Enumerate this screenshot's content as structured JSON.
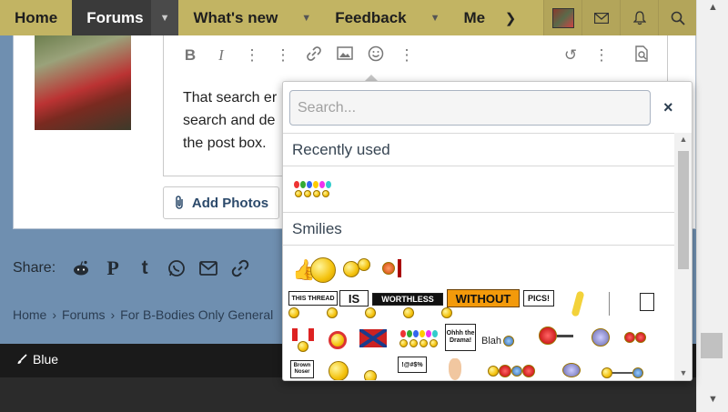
{
  "nav": {
    "items": [
      {
        "label": "Home"
      },
      {
        "label": "Forums"
      },
      {
        "label": "What's new"
      },
      {
        "label": "Feedback"
      },
      {
        "label": "Me"
      }
    ]
  },
  "editor": {
    "lines": [
      "That search er",
      "search and de",
      "the post box."
    ]
  },
  "add_photos": {
    "label": "Add Photos"
  },
  "share": {
    "label": "Share:"
  },
  "breadcrumb": [
    "Home",
    "Forums",
    "For B-Bodies Only General"
  ],
  "footer": {
    "style_label": "Blue"
  },
  "smilie_popup": {
    "search_placeholder": "Search...",
    "close": "×",
    "recent_heading": "Recently used",
    "smilies_heading": "Smilies",
    "signs": [
      "THIS THREAD",
      "IS",
      "WORTHLESS",
      "WITHOUT",
      "PICS!",
      "Ohhh the Drama!",
      "Blah",
      "Brown Noser",
      "!@#$%"
    ]
  },
  "colors": {
    "nav_bg": "#c2b463",
    "nav_active": "#3a3a3a",
    "page_bg": "#6f8fb0",
    "footer_bg": "#1a1a1a",
    "link": "#2c4a6b"
  }
}
